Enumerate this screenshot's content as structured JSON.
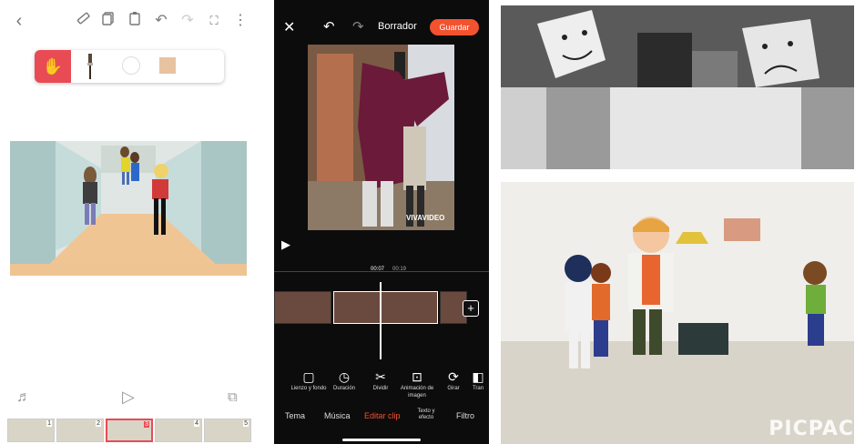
{
  "drawing_app": {
    "toolbar_icons": [
      "back-icon",
      "ruler-icon",
      "copy-icon",
      "paste-icon",
      "undo-icon",
      "redo-icon",
      "fullscreen-icon",
      "more-icon"
    ],
    "bottom_icons": [
      "music-icon",
      "play-icon",
      "layers-icon"
    ],
    "frame_numbers": [
      "1",
      "2",
      "3",
      "4",
      "5"
    ],
    "accent": "#e94b55",
    "selected_color": "#e8c3a1"
  },
  "video_editor": {
    "title": "Borrador",
    "save_label": "Guardar",
    "watermark": "VIVAVIDEO",
    "time_current": "00:07",
    "time_total": "00:19",
    "accent": "#f3522f",
    "tools": [
      {
        "icon": "canvas-icon",
        "label": "Lienzo y fondo"
      },
      {
        "icon": "duration-icon",
        "label": "Duración"
      },
      {
        "icon": "scissors-icon",
        "label": "Dividir"
      },
      {
        "icon": "image-animation-icon",
        "label": "Animación de imagen"
      },
      {
        "icon": "rotate-icon",
        "label": "Girar"
      },
      {
        "icon": "transition-icon",
        "label": "Tran"
      }
    ],
    "tabs": [
      "Tema",
      "Música",
      "Editar clip",
      "Texto y efecto",
      "Filtro"
    ],
    "active_tab": "Editar clip"
  },
  "photos": {
    "watermark": "PICPAC"
  }
}
